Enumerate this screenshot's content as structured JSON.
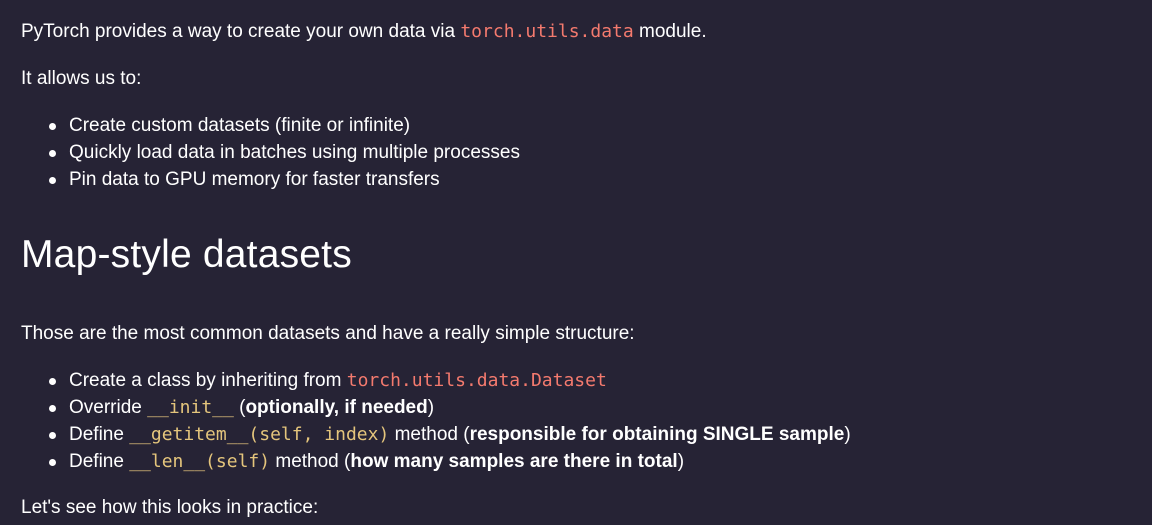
{
  "intro": {
    "text_before": "PyTorch provides a way to create your own data via ",
    "code": "torch.utils.data",
    "text_after": " module."
  },
  "allows_text": "It allows us to:",
  "features": [
    "Create custom datasets (finite or infinite)",
    "Quickly load data in batches using multiple processes",
    "Pin data to GPU memory for faster transfers"
  ],
  "heading": "Map-style datasets",
  "map_intro": "Those are the most common datasets and have a really simple structure:",
  "steps": {
    "s1": {
      "text": "Create a class by inheriting from ",
      "code": "torch.utils.data.Dataset"
    },
    "s2": {
      "text": "Override ",
      "code": "__init__",
      "space": " ",
      "paren_open": "(",
      "bold": "optionally, if needed",
      "paren_close": ")"
    },
    "s3": {
      "text": "Define ",
      "code": "__getitem__(self, index)",
      "middle": " method (",
      "bold": "responsible for obtaining SINGLE sample",
      "paren_close": ")"
    },
    "s4": {
      "text": "Define ",
      "code": "__len__(self)",
      "middle": " method (",
      "bold": "how many samples are there in total",
      "paren_close": ")"
    }
  },
  "outro": "Let's see how this looks in practice:"
}
